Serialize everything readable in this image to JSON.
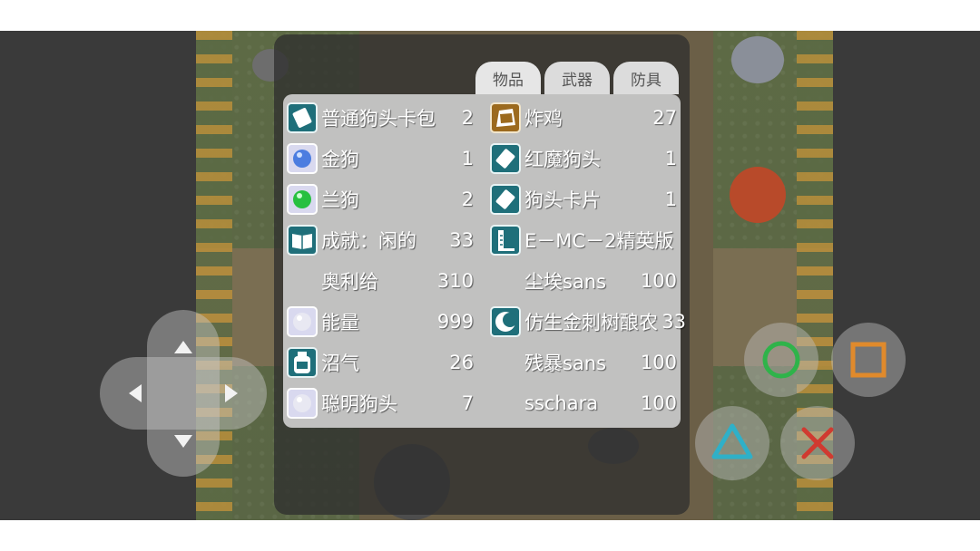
{
  "tabs": [
    {
      "label": "物品"
    },
    {
      "label": "武器"
    },
    {
      "label": "防具"
    }
  ],
  "items_left": [
    {
      "name": "普通狗头卡包",
      "qty": "2",
      "icon": "card-pack-icon"
    },
    {
      "name": "金狗",
      "qty": "1",
      "icon": "blue-orb-icon"
    },
    {
      "name": "兰狗",
      "qty": "2",
      "icon": "green-orb-icon"
    },
    {
      "name": "成就：闲的",
      "qty": "33",
      "icon": "book-icon"
    },
    {
      "name": "奥利给",
      "qty": "310",
      "icon": ""
    },
    {
      "name": "能量",
      "qty": "999",
      "icon": "white-orb-icon"
    },
    {
      "name": "沼气",
      "qty": "26",
      "icon": "jar-icon"
    },
    {
      "name": "聪明狗头",
      "qty": "7",
      "icon": "white-orb-icon"
    }
  ],
  "items_right": [
    {
      "name": "炸鸡",
      "qty": "27",
      "icon": "fried-chicken-icon"
    },
    {
      "name": "红魔狗头",
      "qty": "1",
      "icon": "card-icon"
    },
    {
      "name": "狗头卡片",
      "qty": "1",
      "icon": "card-icon"
    },
    {
      "name": "E－MC－2精英版",
      "qty": "",
      "icon": "flask-icon"
    },
    {
      "name": "尘埃sans",
      "qty": "100",
      "icon": ""
    },
    {
      "name": "仿生金刺树酿农",
      "qty": "33",
      "icon": "crescent-icon"
    },
    {
      "name": "残暴sans",
      "qty": "100",
      "icon": ""
    },
    {
      "name": "sschara",
      "qty": "100",
      "icon": ""
    }
  ],
  "colors": {
    "icon_bg": "#1f6f7a",
    "circle_button": "#2fb34a",
    "square_button": "#e08a2c",
    "triangle_button": "#2fb0c8",
    "cross_button": "#d03a30"
  }
}
